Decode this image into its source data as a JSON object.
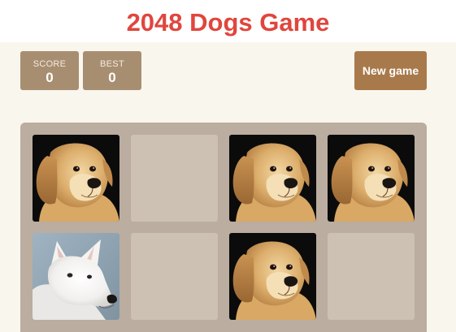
{
  "header": {
    "title": "2048 Dogs Game"
  },
  "scores": {
    "score_label": "SCORE",
    "score_value": "0",
    "best_label": "BEST",
    "best_value": "0"
  },
  "controls": {
    "new_game_label": "New game"
  },
  "board": {
    "size": 4,
    "rows": [
      [
        "golden-puppy",
        "empty",
        "golden-puppy",
        "golden-puppy"
      ],
      [
        "white-dog",
        "empty",
        "golden-puppy",
        "empty"
      ]
    ]
  },
  "colors": {
    "title": "#e0463d",
    "score_box": "#a88e71",
    "new_game_button": "#a87a4b",
    "board": "#bbad9f",
    "empty_cell": "#cdc1b3",
    "background": "#f9f6ee"
  }
}
